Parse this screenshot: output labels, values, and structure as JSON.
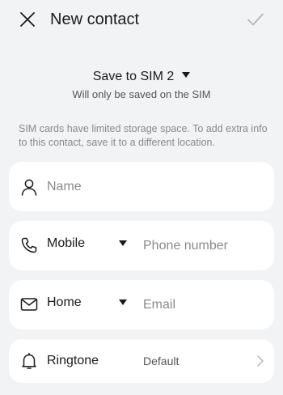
{
  "header": {
    "title": "New contact"
  },
  "save_location": {
    "label": "Save to SIM 2",
    "subtitle": "Will only be saved on the SIM"
  },
  "info": {
    "text": "SIM cards have limited storage space. To add extra info to this contact, save it to a different location."
  },
  "fields": {
    "name": {
      "placeholder": "Name"
    },
    "phone": {
      "type_label": "Mobile",
      "placeholder": "Phone number"
    },
    "email": {
      "type_label": "Home",
      "placeholder": "Email"
    },
    "ringtone": {
      "label": "Ringtone",
      "value": "Default"
    }
  },
  "icons": {
    "close": "close-icon",
    "confirm": "checkmark-icon",
    "name": "person-icon",
    "phone": "phone-icon",
    "email": "envelope-icon",
    "ringtone": "bell-icon",
    "chevron": "chevron-right-icon"
  },
  "colors": {
    "background": "#f1f3f5",
    "card": "#ffffff",
    "text_primary": "#1a1a1a",
    "text_secondary": "#8a8a8a",
    "confirm_disabled": "#b5b5b5"
  }
}
